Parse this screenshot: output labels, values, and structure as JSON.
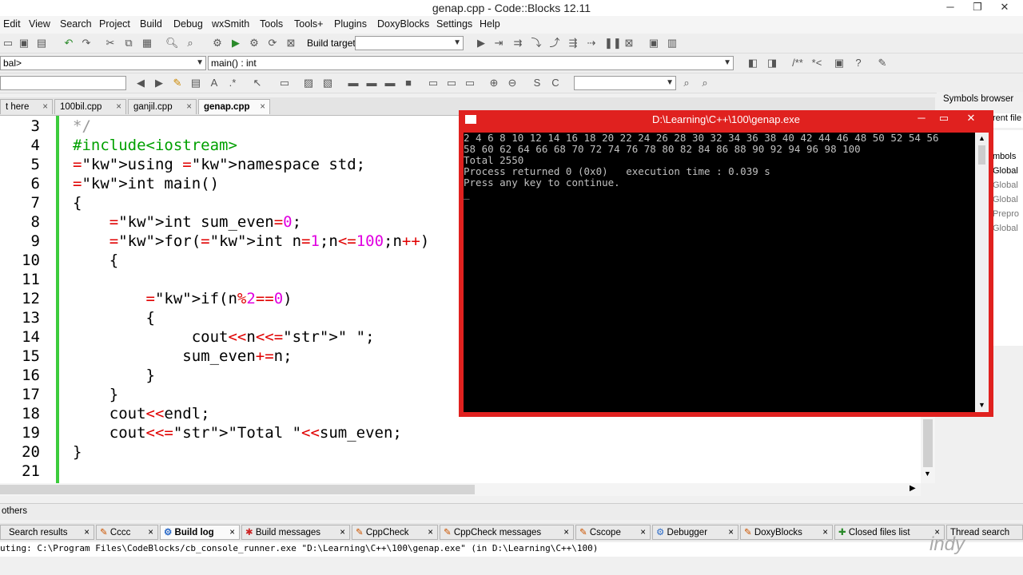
{
  "window": {
    "title": "genap.cpp - Code::Blocks 12.11"
  },
  "menu": [
    "Edit",
    "View",
    "Search",
    "Project",
    "Build",
    "Debug",
    "wxSmith",
    "Tools",
    "Tools+",
    "Plugins",
    "DoxyBlocks",
    "Settings",
    "Help"
  ],
  "toolbar": {
    "build_target_label": "Build target:",
    "build_target_value": ""
  },
  "scope_bar": {
    "scope": "bal>",
    "function": "main() : int",
    "search_value": ""
  },
  "tabs": [
    {
      "label": "t here"
    },
    {
      "label": "100bil.cpp"
    },
    {
      "label": "ganjil.cpp"
    },
    {
      "label": "genap.cpp",
      "active": true
    }
  ],
  "code_lines": [
    {
      "n": "3",
      "text": "*/"
    },
    {
      "n": "4",
      "text": "#include<iostream>"
    },
    {
      "n": "5",
      "text": "using namespace std;"
    },
    {
      "n": "6",
      "text": "int main()"
    },
    {
      "n": "7",
      "text": "{"
    },
    {
      "n": "8",
      "text": "    int sum_even=0;"
    },
    {
      "n": "9",
      "text": "    for(int n=1;n<=100;n++)"
    },
    {
      "n": "10",
      "text": "    {"
    },
    {
      "n": "11",
      "text": ""
    },
    {
      "n": "12",
      "text": "        if(n%2==0)"
    },
    {
      "n": "13",
      "text": "        {"
    },
    {
      "n": "14",
      "text": "             cout<<n<<\" \";"
    },
    {
      "n": "15",
      "text": "            sum_even+=n;"
    },
    {
      "n": "16",
      "text": "        }"
    },
    {
      "n": "17",
      "text": "    }"
    },
    {
      "n": "18",
      "text": "    cout<<endl;"
    },
    {
      "n": "19",
      "text": "    cout<<\"Total \"<<sum_even;"
    },
    {
      "n": "20",
      "text": "}"
    },
    {
      "n": "21",
      "text": ""
    }
  ],
  "console": {
    "title": "D:\\Learning\\C++\\100\\genap.exe",
    "output": "2 4 6 8 10 12 14 16 18 20 22 24 26 28 30 32 34 36 38 40 42 44 46 48 50 52 54 56\n58 60 62 64 66 68 70 72 74 76 78 80 82 84 86 88 90 92 94 96 98 100\nTotal 2550\nProcess returned 0 (0x0)   execution time : 0.039 s\nPress any key to continue.\n_"
  },
  "right_panel": {
    "title": "Symbols browser",
    "tab_label": "rent file",
    "heading": "mbols",
    "items": [
      "Global",
      "Global",
      "Global",
      "Prepro",
      "Global"
    ]
  },
  "bottom": {
    "others_label": "others",
    "tabs": [
      "Search results",
      "Cccc",
      "Build log",
      "Build messages",
      "CppCheck",
      "CppCheck messages",
      "Cscope",
      "Debugger",
      "DoxyBlocks",
      "Closed files list",
      "Thread search"
    ],
    "active_tab": "Build log",
    "log_line": "uting: C:\\Program Files\\CodeBlocks/cb_console_runner.exe \"D:\\Learning\\C++\\100\\genap.exe\"  (in D:\\Learning\\C++\\100)"
  },
  "watermark": "indy",
  "colors": {
    "console_frame": "#e0211f",
    "change_bar": "#3ccc3c",
    "keyword": "#00008b"
  }
}
